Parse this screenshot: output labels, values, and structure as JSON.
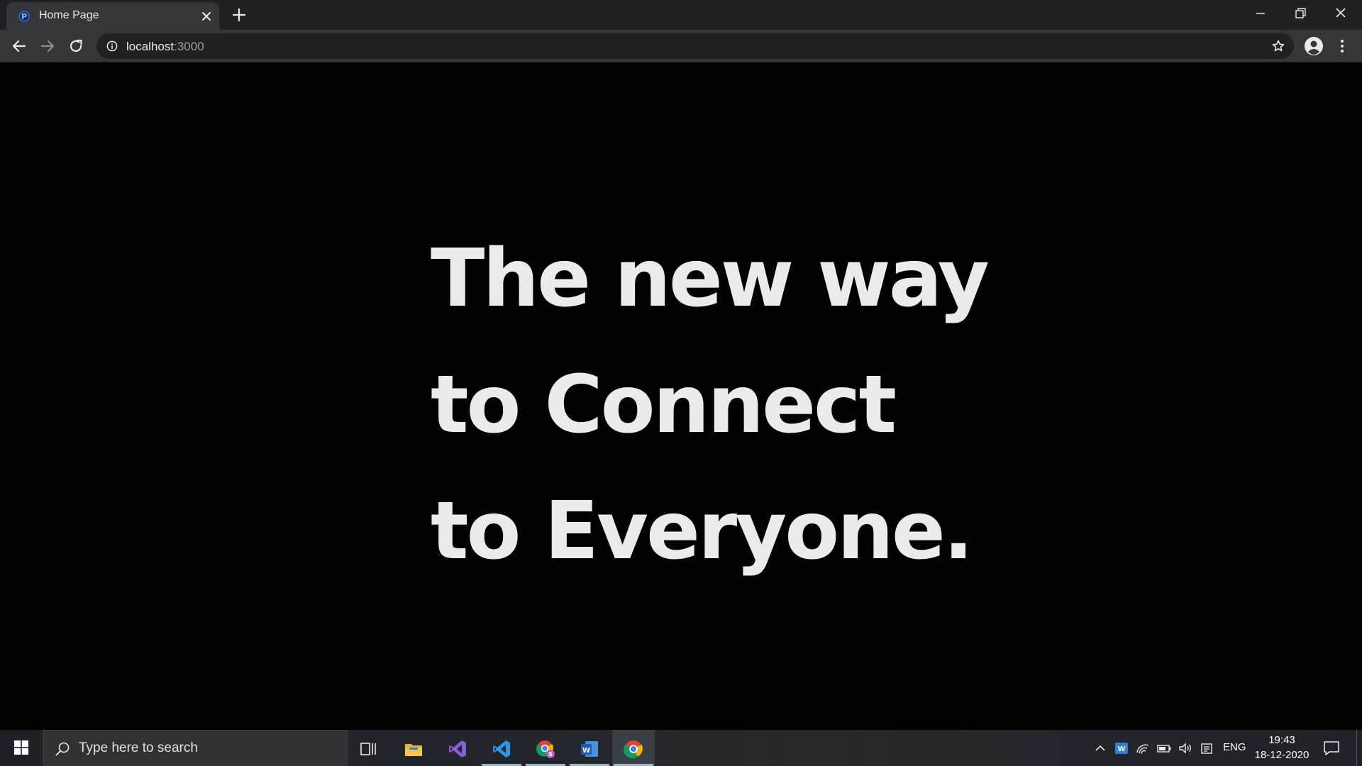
{
  "browser": {
    "tab": {
      "title": "Home Page",
      "favicon": "p-logo-icon"
    },
    "address": {
      "host": "localhost",
      "port": ":3000"
    }
  },
  "page": {
    "hero_lines": [
      "The new way",
      "to Connect",
      "to Everyone."
    ],
    "text_color": "#ebebeb",
    "background": "#000000"
  },
  "taskbar": {
    "search_placeholder": "Type here to search",
    "apps": [
      "task-view",
      "file-explorer",
      "visual-studio",
      "vscode",
      "chrome-profile",
      "word",
      "chrome"
    ],
    "language": "ENG",
    "time": "19:43",
    "date": "18-12-2020"
  }
}
